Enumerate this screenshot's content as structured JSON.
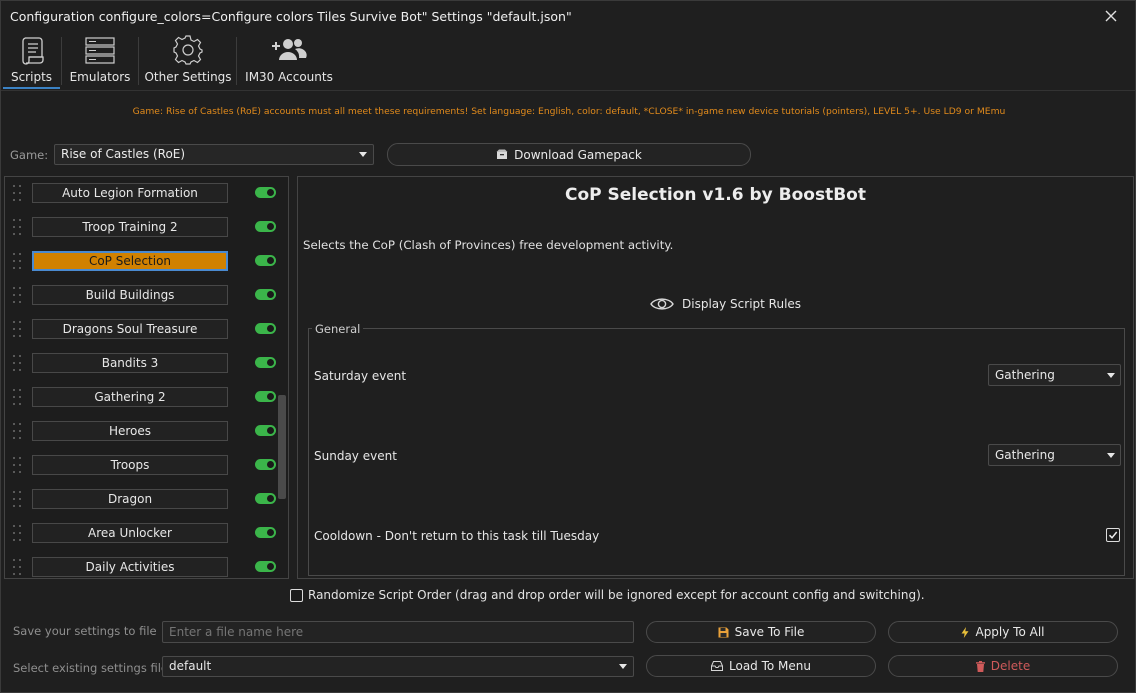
{
  "window": {
    "title": "Configuration configure_colors=Configure colors Tiles Survive Bot\" Settings \"default.json\""
  },
  "tabs": [
    {
      "label": "Scripts",
      "icon": "scroll-icon",
      "active": true
    },
    {
      "label": "Emulators",
      "icon": "servers-icon",
      "active": false
    },
    {
      "label": "Other Settings",
      "icon": "gear-icon",
      "active": false
    },
    {
      "label": "IM30 Accounts",
      "icon": "users-add-icon",
      "active": false
    }
  ],
  "notice": "Game: Rise of Castles (RoE) accounts must all meet these requirements! Set language: English, color: default, *CLOSE* in-game new device tutorials (pointers), LEVEL 5+. Use LD9 or MEmu",
  "game": {
    "label": "Game:",
    "selected": "Rise of Castles (RoE)",
    "download_label": "Download Gamepack"
  },
  "scripts": [
    {
      "label": "Auto Legion Formation",
      "enabled": true,
      "selected": false
    },
    {
      "label": "Troop Training 2",
      "enabled": true,
      "selected": false
    },
    {
      "label": "CoP Selection",
      "enabled": true,
      "selected": true
    },
    {
      "label": "Build Buildings",
      "enabled": true,
      "selected": false
    },
    {
      "label": "Dragons Soul Treasure",
      "enabled": true,
      "selected": false
    },
    {
      "label": "Bandits 3",
      "enabled": true,
      "selected": false
    },
    {
      "label": "Gathering 2",
      "enabled": true,
      "selected": false
    },
    {
      "label": "Heroes",
      "enabled": true,
      "selected": false
    },
    {
      "label": "Troops",
      "enabled": true,
      "selected": false
    },
    {
      "label": "Dragon",
      "enabled": true,
      "selected": false
    },
    {
      "label": "Area Unlocker",
      "enabled": true,
      "selected": false
    },
    {
      "label": "Daily Activities",
      "enabled": true,
      "selected": false
    }
  ],
  "panel": {
    "title": "CoP Selection v1.6 by BoostBot",
    "description": "Selects the CoP (Clash of Provinces) free development activity.",
    "rules_label": "Display Script Rules",
    "group_label": "General",
    "fields": {
      "saturday": {
        "label": "Saturday event",
        "value": "Gathering"
      },
      "sunday": {
        "label": "Sunday event",
        "value": "Gathering"
      },
      "cooldown": {
        "label": "Cooldown - Don't return to this task till Tuesday",
        "checked": true
      }
    }
  },
  "randomize": {
    "label": "Randomize Script Order (drag and drop order will be ignored except for account config and switching).",
    "checked": false
  },
  "footer": {
    "save_label": "Save your settings to file",
    "save_placeholder": "Enter a file name here",
    "select_label": "Select existing settings file",
    "select_value": "default",
    "save_button": "Save To File",
    "apply_button": "Apply To All",
    "load_button": "Load To Menu",
    "delete_button": "Delete"
  },
  "colors": {
    "accent_orange": "#d18100",
    "toggle_green": "#3bb54a",
    "notice_orange": "#e08a1c",
    "delete_red": "#cf5a5a",
    "tab_underline": "#3b82c4"
  }
}
